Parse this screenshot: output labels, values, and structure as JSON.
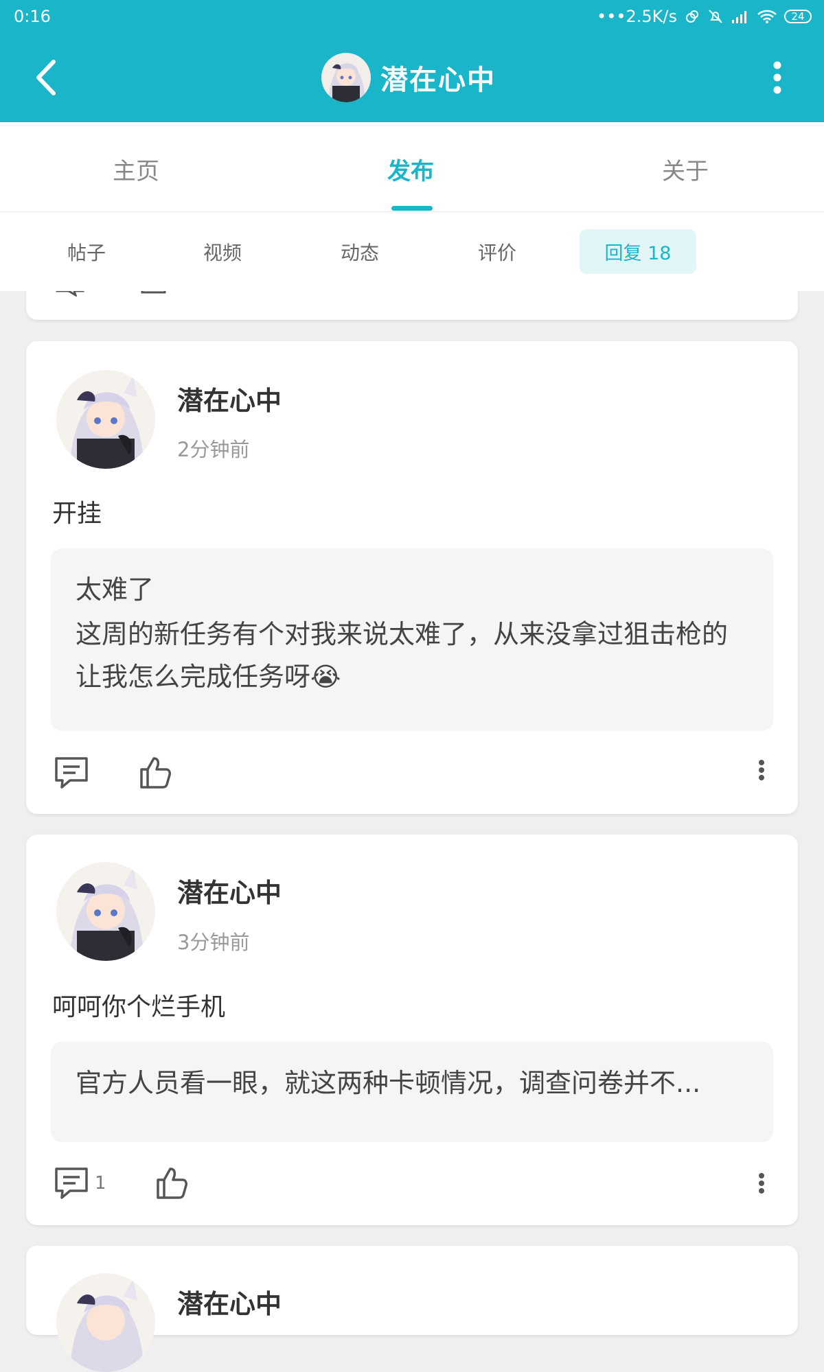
{
  "status_bar": {
    "time": "0:16",
    "speed": "•••2.5K/s",
    "battery": "24"
  },
  "app_bar": {
    "title": "潜在心中"
  },
  "tabs": [
    {
      "label": "主页",
      "active": false
    },
    {
      "label": "发布",
      "active": true
    },
    {
      "label": "关于",
      "active": false
    }
  ],
  "subtabs": [
    {
      "label": "帖子"
    },
    {
      "label": "视频"
    },
    {
      "label": "动态"
    },
    {
      "label": "评价"
    },
    {
      "label": "回复 18",
      "active": true
    }
  ],
  "posts": [
    {
      "author": "潜在心中",
      "time": "2分钟前",
      "text": "开挂",
      "quote_title": "太难了",
      "quote_body": "这周的新任务有个对我来说太难了，从来没拿过狙击枪的让我怎么完成任务呀😭",
      "comment_count": ""
    },
    {
      "author": "潜在心中",
      "time": "3分钟前",
      "text": "呵呵你个烂手机",
      "quote_body": "官方人员看一眼，就这两种卡顿情况，调查问卷并不...",
      "comment_count": "1"
    },
    {
      "author": "潜在心中"
    }
  ],
  "colors": {
    "accent": "#1ab5c8",
    "background": "#efefef"
  }
}
